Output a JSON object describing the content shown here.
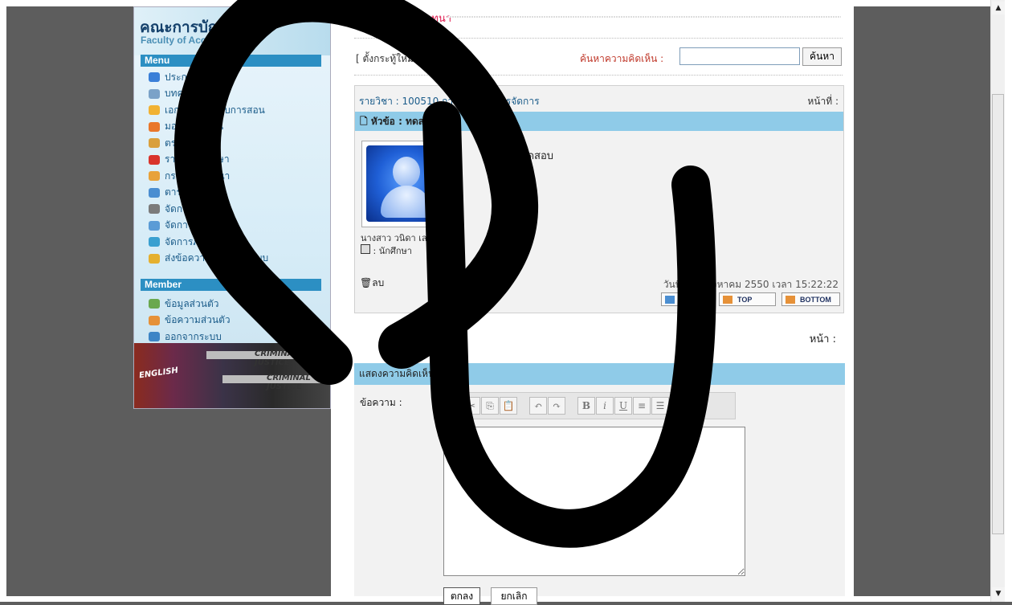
{
  "sidebar": {
    "brand_thai": "คณะการบัญชี",
    "brand_en": "Faculty of Accountancy",
    "menu_title": "Menu",
    "menu_items": [
      {
        "label": "ประกาศ",
        "icon": "announcement-icon",
        "color": "#3a7fd8"
      },
      {
        "label": "บทความ",
        "icon": "article-icon",
        "color": "#7aa2c8"
      },
      {
        "label": "เอกสารประกอบการสอน",
        "icon": "document-icon",
        "color": "#f1b233"
      },
      {
        "label": "มอบหมายงาน",
        "icon": "assignment-icon",
        "color": "#e9772b"
      },
      {
        "label": "ตรวจงาน",
        "icon": "check-work-icon",
        "color": "#d9a03d"
      },
      {
        "label": "รายชื่อนักศึกษา",
        "icon": "student-list-icon",
        "color": "#d9342c"
      },
      {
        "label": "กระดานสนทนา",
        "icon": "webboard-icon",
        "color": "#e8a23a"
      },
      {
        "label": "ตารางสอน",
        "icon": "schedule-icon",
        "color": "#4b8ed1"
      },
      {
        "label": "จัดการรายวิชา",
        "icon": "course-manage-icon",
        "color": "#7b7b7b"
      },
      {
        "label": "จัดการเมนู",
        "icon": "menu-manage-icon",
        "color": "#5a9bd6"
      },
      {
        "label": "จัดการภาษา",
        "icon": "language-icon",
        "color": "#3aa0d0"
      },
      {
        "label": "ส่งข้อความถึงผู้ดูแลระบบ",
        "icon": "message-admin-icon",
        "color": "#e5b02f"
      }
    ],
    "member_title": "Member",
    "member_items": [
      {
        "label": "ข้อมูลส่วนตัว",
        "icon": "profile-icon",
        "color": "#6aa84f"
      },
      {
        "label": "ข้อความส่วนตัว",
        "icon": "private-message-icon",
        "color": "#e69138"
      },
      {
        "label": "ออกจากระบบ",
        "icon": "logout-icon",
        "color": "#3d85c6"
      }
    ],
    "book_text_1": "ENGLISH",
    "book_text_2": "CRIMINAL JUSTICE"
  },
  "main": {
    "board_title": "กระดานสนทนา",
    "new_topic": "[ ตั้งกระทู้ใหม่ ]",
    "search_label": "ค้นหาความคิดเห็น :",
    "search_value": "",
    "search_button": "ค้นหา",
    "post": {
      "course": "รายวิชา : 100510  การบัญชีเพื่อการจัดการ",
      "page_label": "หน้าที่ :",
      "topic": "หัวข้อ : ทดสอบ",
      "body": "ทดสอบทดสอบ",
      "author": "นางสาว วนิดา เลาหมู่",
      "role": ": นักศึกษา",
      "delete": "ลบ",
      "date": "วันที่ : 09 สิงหาคม 2550 เวลา 15:22:22",
      "reply": "REPLY",
      "top": "TOP",
      "bottom": "BOTTOM"
    },
    "page_label": "หน้า :",
    "comment": {
      "title": "แสดงความคิดเห็น",
      "message_label": "ข้อความ :",
      "editor_value": "",
      "ok": "ตกลง",
      "cancel": "ยกเลิก"
    }
  },
  "colors": {
    "topic_bar": "#8fcbe8",
    "menu_bar": "#2c8fc3",
    "board_title": "#e01a4f"
  }
}
